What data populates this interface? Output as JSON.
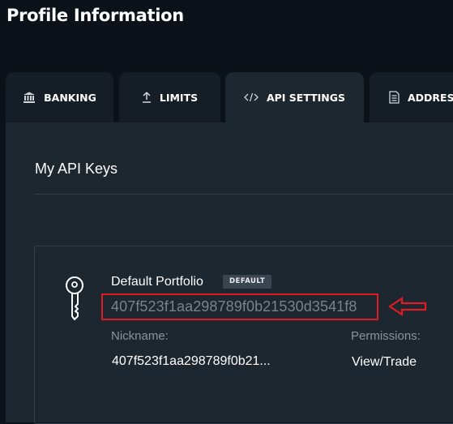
{
  "header": {
    "title": "Profile Information"
  },
  "tabs": [
    {
      "label": "BANKING",
      "icon": "bank-icon"
    },
    {
      "label": "LIMITS",
      "icon": "upload-icon"
    },
    {
      "label": "API SETTINGS",
      "icon": "code-icon",
      "active": true
    },
    {
      "label": "ADDRESS",
      "icon": "document-icon"
    }
  ],
  "api_keys": {
    "section_title": "My API Keys",
    "card": {
      "icon": "key-icon",
      "portfolio_name": "Default Portfolio",
      "badge": "DEFAULT",
      "key": "407f523f1aa298789f0b21530d3541f8",
      "nickname_label": "Nickname:",
      "nickname_value": "407f523f1aa298789f0b21...",
      "permissions_label": "Permissions:",
      "permissions_value": "View/Trade"
    }
  },
  "annotation": {
    "highlight_color": "#e01b24",
    "arrow_icon": "arrow-left-icon"
  },
  "colors": {
    "background": "#0b1219",
    "panel": "#1d2730",
    "tab": "#151e26",
    "muted_text": "#8a939b"
  }
}
